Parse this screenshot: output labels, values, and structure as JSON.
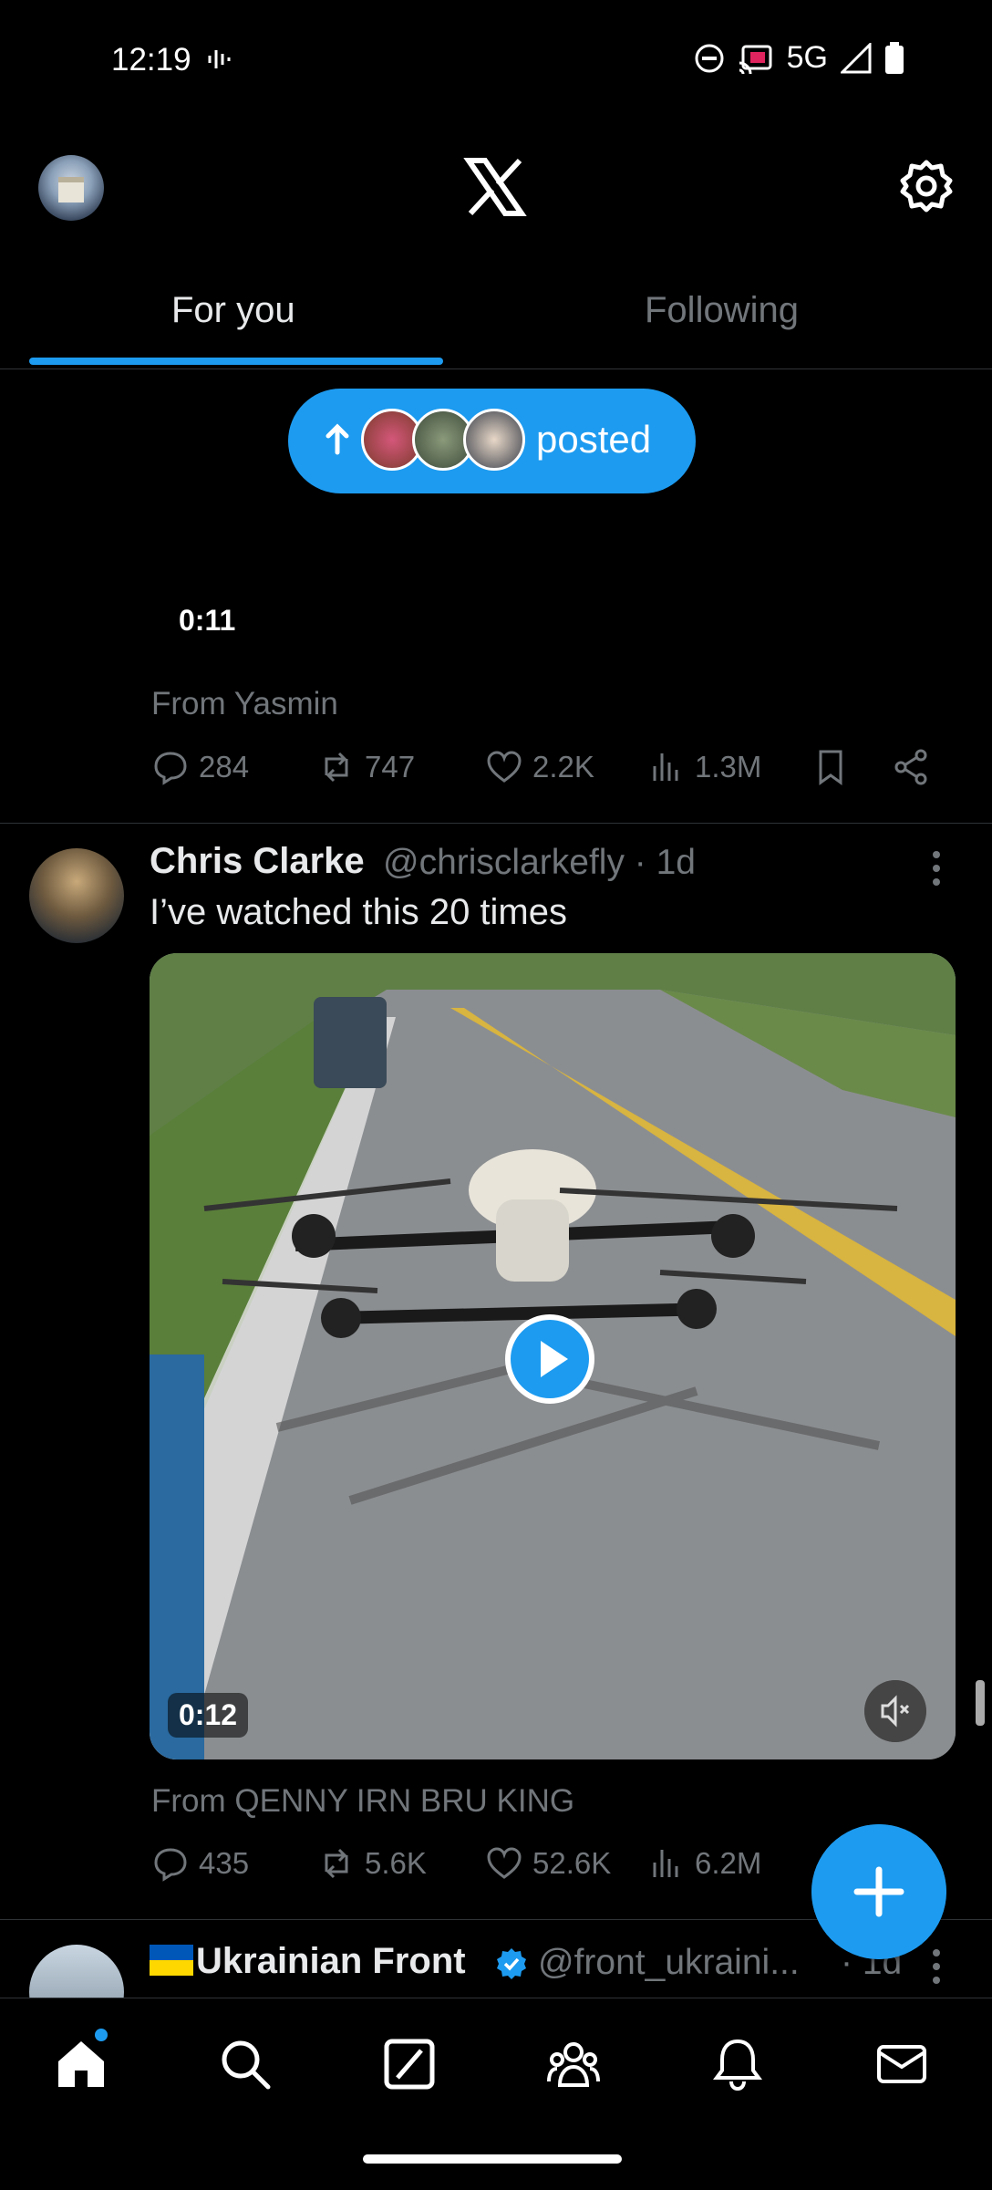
{
  "status_bar": {
    "time": "12:19",
    "network": "5G"
  },
  "tabs": [
    {
      "label": "For you"
    },
    {
      "label": "Following"
    }
  ],
  "new_posts_pill": {
    "label": "posted"
  },
  "previous_post": {
    "duration": "0:11",
    "from_label": "From Yasmin",
    "stats": {
      "replies": "284",
      "reposts": "747",
      "likes": "2.2K",
      "views": "1.3M"
    }
  },
  "post": {
    "name": "Chris Clarke",
    "handle": "@chrisclarkefly · 1d",
    "text": "I’ve watched this 20 times",
    "duration": "0:12",
    "from_label": "From QENNY IRN BRU KING",
    "stats": {
      "replies": "435",
      "reposts": "5.6K",
      "likes": "52.6K",
      "views": "6.2M"
    }
  },
  "next_post": {
    "name": "Ukrainian Front",
    "handle": "@front_ukraini...",
    "time": "· 1d"
  },
  "colors": {
    "accent": "#1d9bf0",
    "muted": "#71767b",
    "background": "#000000"
  },
  "icons": [
    "home-icon",
    "search-icon",
    "grok-icon",
    "communities-icon",
    "bell-icon",
    "mail-icon",
    "gear-icon",
    "x-logo-icon"
  ]
}
